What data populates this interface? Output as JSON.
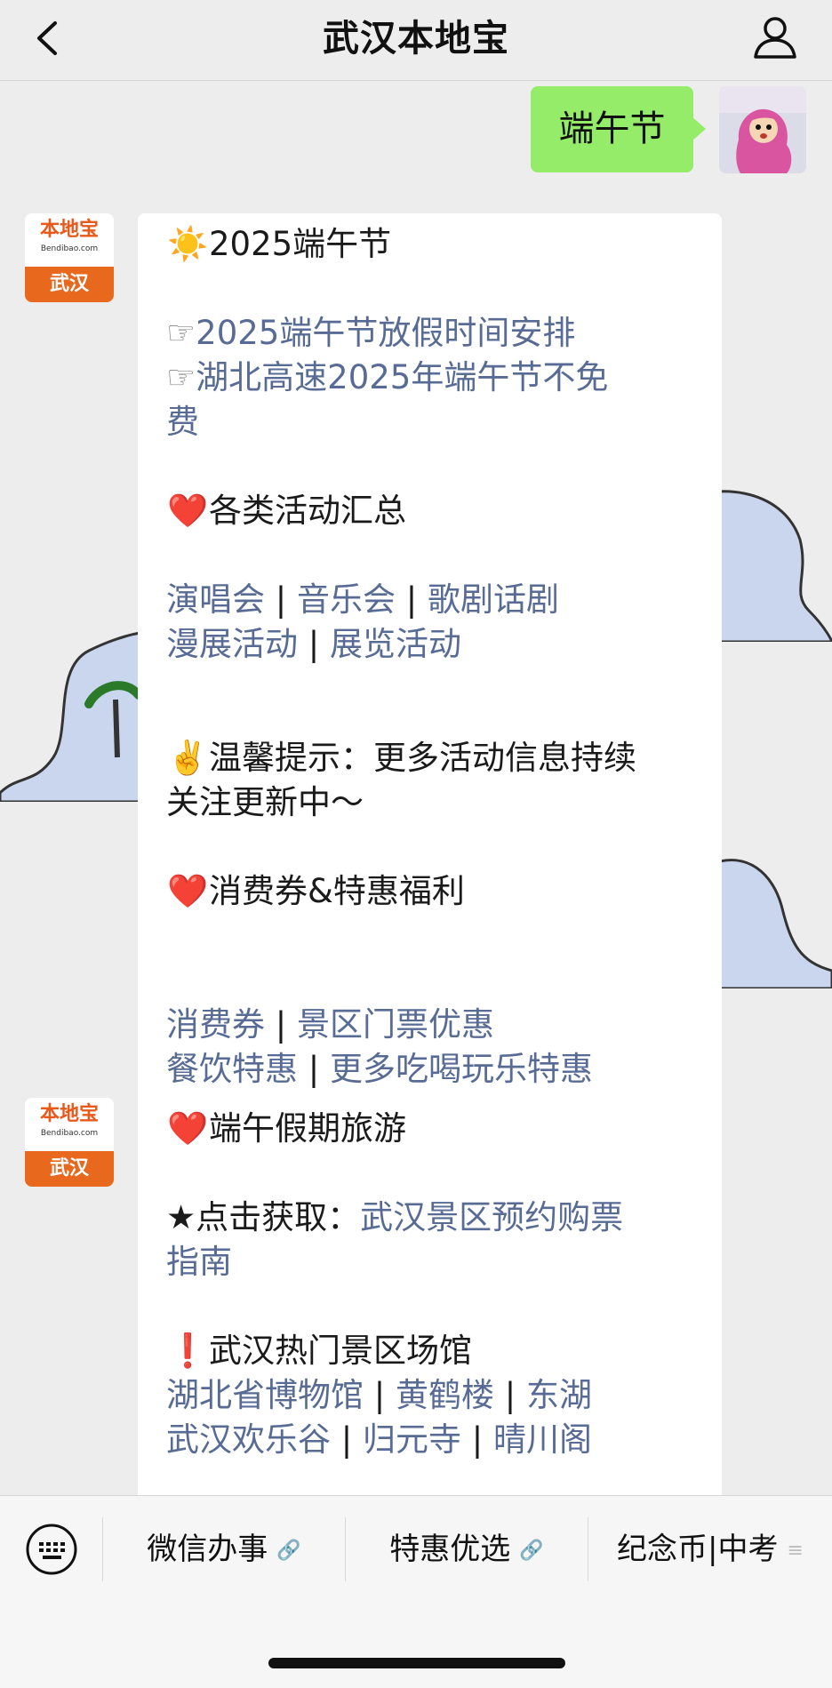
{
  "header": {
    "title": "武汉本地宝",
    "back_icon": "chevron-left-icon",
    "profile_icon": "user-icon"
  },
  "chat": {
    "user_message": "端午节",
    "bot_brand": "本地宝",
    "bot_brand_sub": "Bendibao.com",
    "bot_city": "武汉",
    "message1": {
      "title_emoji": "☀️",
      "title": "2025端午节",
      "link_prefix": "☞",
      "link1": "2025端午节放假时间安排",
      "link2a": "湖北高速2025年端午节不免",
      "link2b": "费",
      "section1_emoji": "❤️",
      "section1": "各类活动汇总",
      "act_links_row1": [
        "演唱会",
        "音乐会",
        "歌剧话剧"
      ],
      "act_links_row2": [
        "漫展活动",
        "展览活动"
      ],
      "separator": "|",
      "tip_emoji": "✌️",
      "tip_line1": "温馨提示：更多活动信息持续",
      "tip_line2": "关注更新中～",
      "section2_emoji": "❤️",
      "section2": "消费券&特惠福利",
      "deal_links_row1": [
        "消费券",
        "景区门票优惠"
      ],
      "deal_links_row2": [
        "餐饮特惠",
        "更多吃喝玩乐特惠"
      ]
    },
    "message2": {
      "section_emoji": "❤️",
      "section": "端午假期旅游",
      "star_prefix": "★点击获取：",
      "guide_link_a": "武汉景区预约购票",
      "guide_link_b": "指南",
      "hot_emoji": "❗",
      "hot_title": "武汉热门景区场馆",
      "venue_row1": [
        "湖北省博物馆",
        "黄鹤楼",
        "东湖"
      ],
      "venue_row2": [
        "武汉欢乐谷",
        "归元寺",
        "晴川阁"
      ]
    }
  },
  "menu": {
    "keyboard_icon": "keyboard-icon",
    "items": [
      {
        "label": "微信办事",
        "icon": "link-icon"
      },
      {
        "label": "特惠优选",
        "icon": "link-icon"
      },
      {
        "label": "纪念币|中考",
        "icon": "menu-lines-icon"
      }
    ]
  }
}
